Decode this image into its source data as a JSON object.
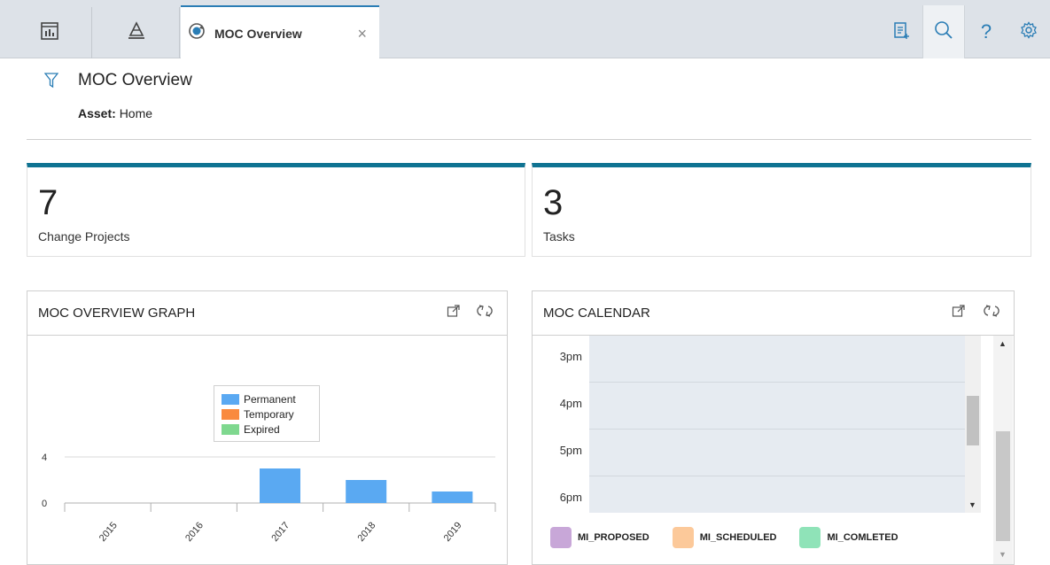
{
  "tabs": {
    "icon_tabs": [
      "dashboard-icon",
      "pyramid-icon"
    ],
    "active": {
      "label": "MOC Overview",
      "icon": "moc-refresh-icon",
      "close": "×"
    }
  },
  "toolbar": {
    "tools": [
      "clipboard-add-icon",
      "search-icon",
      "help-icon",
      "gear-icon"
    ],
    "help_glyph": "?"
  },
  "header": {
    "title": "MOC Overview",
    "asset_label": "Asset:",
    "asset_value": "Home"
  },
  "kpis": [
    {
      "value": "7",
      "label": "Change Projects"
    },
    {
      "value": "3",
      "label": "Tasks"
    }
  ],
  "graph_widget": {
    "title": "MOC OVERVIEW GRAPH"
  },
  "calendar_widget": {
    "title": "MOC CALENDAR",
    "times": [
      "3pm",
      "4pm",
      "5pm",
      "6pm"
    ],
    "legend": [
      {
        "label": "MI_PROPOSED",
        "color": "#c8a7d8"
      },
      {
        "label": "MI_SCHEDULED",
        "color": "#fcc99a"
      },
      {
        "label": "MI_COMLETED",
        "color": "#8fe3b8"
      }
    ]
  },
  "colors": {
    "accent": "#0f7392",
    "tab_accent": "#2a7db5"
  },
  "chart_data": {
    "type": "bar",
    "categories": [
      "2015",
      "2016",
      "2017",
      "2018",
      "2019"
    ],
    "series": [
      {
        "name": "Permanent",
        "color": "#5aa9f2",
        "values": [
          0,
          0,
          3,
          2,
          1
        ]
      },
      {
        "name": "Temporary",
        "color": "#f98a3e",
        "values": [
          0,
          0,
          0,
          0,
          0
        ]
      },
      {
        "name": "Expired",
        "color": "#7fd88f",
        "values": [
          0,
          0,
          0,
          0,
          0
        ]
      }
    ],
    "yticks": [
      "0",
      "4"
    ],
    "ylim": [
      0,
      13
    ],
    "grid": true,
    "legend_position": "top-center"
  }
}
